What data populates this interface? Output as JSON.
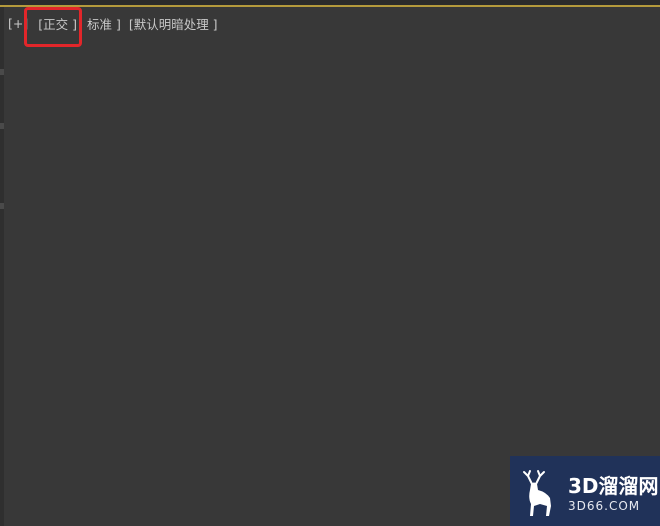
{
  "viewport": {
    "labels": {
      "menu": "[+]",
      "view": "[正交 ]",
      "shading_mode": "标准 ]",
      "lighting": "[默认明暗处理 ]"
    }
  },
  "watermark": {
    "brand_cn": "3D溜溜网",
    "brand_en": "3D66.COM",
    "logo_icon": "deer-logo-icon"
  },
  "colors": {
    "viewport_bg": "#383838",
    "highlight": "#e2262a",
    "accent_line": "#b49a3c",
    "watermark_bg": "#1e325c"
  }
}
